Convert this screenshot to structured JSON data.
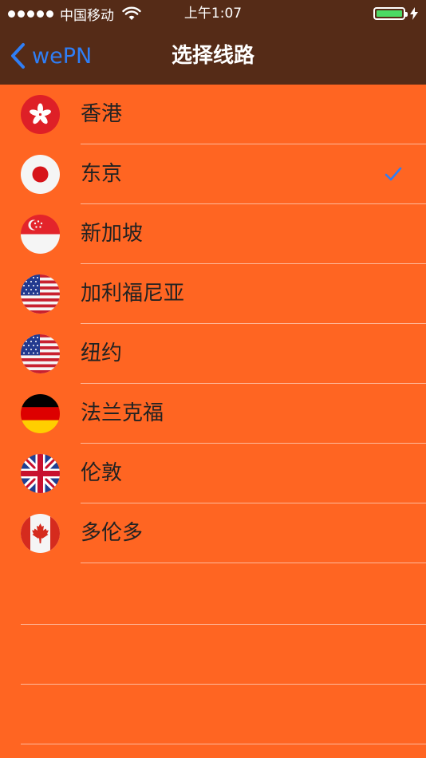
{
  "status_bar": {
    "carrier": "中国移动",
    "time": "上午1:07"
  },
  "nav": {
    "back_label": "wePN",
    "title": "选择线路"
  },
  "routes": [
    {
      "name": "香港",
      "flag": "hong-kong-flag-icon",
      "selected": false
    },
    {
      "name": "东京",
      "flag": "japan-flag-icon",
      "selected": true
    },
    {
      "name": "新加坡",
      "flag": "singapore-flag-icon",
      "selected": false
    },
    {
      "name": "加利福尼亚",
      "flag": "usa-flag-icon",
      "selected": false
    },
    {
      "name": "纽约",
      "flag": "usa-flag-icon",
      "selected": false
    },
    {
      "name": "法兰克福",
      "flag": "germany-flag-icon",
      "selected": false
    },
    {
      "name": "伦敦",
      "flag": "uk-flag-icon",
      "selected": false
    },
    {
      "name": "多伦多",
      "flag": "canada-flag-icon",
      "selected": false
    }
  ],
  "colors": {
    "background": "#ff6522",
    "bar": "#552b17",
    "accent": "#2f7ef5",
    "battery": "#4cd964"
  }
}
